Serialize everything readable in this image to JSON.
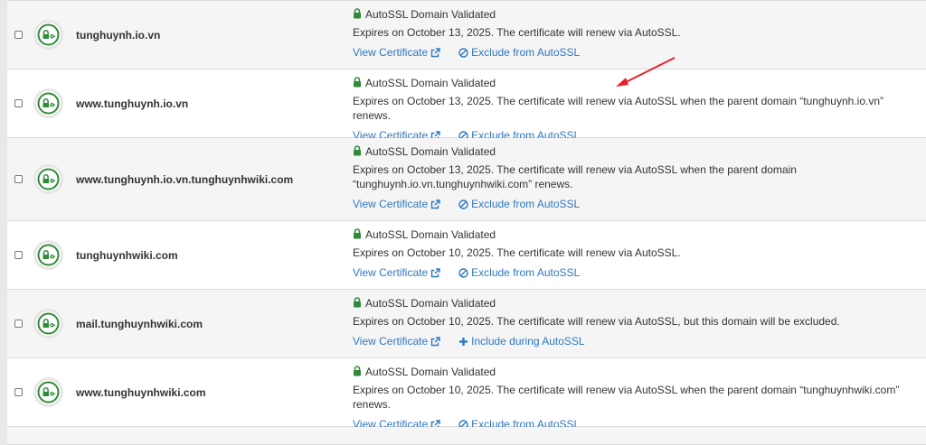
{
  "colors": {
    "link": "#2e78c0",
    "lock_green": "#2f8a3a",
    "status_green": "#2f8a3a",
    "row_alt_bg": "#f5f5f5",
    "annotation_arrow": "#e8202a"
  },
  "icons": {
    "status": "lock-key-icon",
    "validated": "lock-icon",
    "view": "external-link-icon",
    "exclude": "ban-icon",
    "include": "plus-icon"
  },
  "rows": [
    {
      "domain": "tunghuynh.io.vn",
      "status": "AutoSSL Domain Validated",
      "expiry_lines": [
        "Expires on October 13, 2025. The certificate will renew via AutoSSL."
      ],
      "view_label": "View Certificate",
      "action_label": "Exclude from AutoSSL",
      "action_type": "exclude"
    },
    {
      "domain": "www.tunghuynh.io.vn",
      "status": "AutoSSL Domain Validated",
      "expiry_lines": [
        "Expires on October 13, 2025. The certificate will renew via AutoSSL when the parent domain “tunghuynh.io.vn” renews."
      ],
      "view_label": "View Certificate",
      "action_label": "Exclude from AutoSSL",
      "action_type": "exclude"
    },
    {
      "domain": "www.tunghuynh.io.vn.tunghuynhwiki.com",
      "status": "AutoSSL Domain Validated",
      "expiry_lines": [
        "Expires on October 13, 2025. The certificate will renew via AutoSSL when the parent domain",
        "“tunghuynh.io.vn.tunghuynhwiki.com” renews."
      ],
      "view_label": "View Certificate",
      "action_label": "Exclude from AutoSSL",
      "action_type": "exclude"
    },
    {
      "domain": "tunghuynhwiki.com",
      "status": "AutoSSL Domain Validated",
      "expiry_lines": [
        "Expires on October 10, 2025. The certificate will renew via AutoSSL."
      ],
      "view_label": "View Certificate",
      "action_label": "Exclude from AutoSSL",
      "action_type": "exclude"
    },
    {
      "domain": "mail.tunghuynhwiki.com",
      "status": "AutoSSL Domain Validated",
      "expiry_lines": [
        "Expires on October 10, 2025. The certificate will renew via AutoSSL, but this domain will be excluded."
      ],
      "view_label": "View Certificate",
      "action_label": "Include during AutoSSL",
      "action_type": "include"
    },
    {
      "domain": "www.tunghuynhwiki.com",
      "status": "AutoSSL Domain Validated",
      "expiry_lines": [
        "Expires on October 10, 2025. The certificate will renew via AutoSSL when the parent domain “tunghuynhwiki.com” renews."
      ],
      "view_label": "View Certificate",
      "action_label": "Exclude from AutoSSL",
      "action_type": "exclude"
    }
  ]
}
